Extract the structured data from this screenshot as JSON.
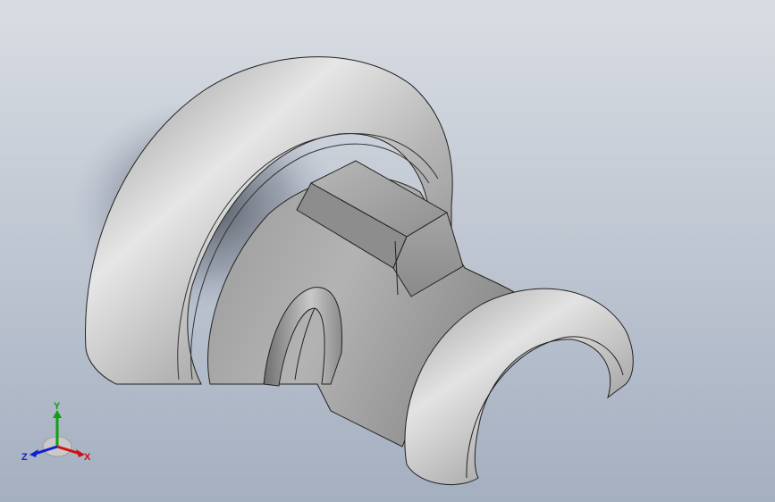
{
  "viewport": {
    "background_top": "#d9dde3",
    "background_bottom": "#a4afc0",
    "model_color": "#a9a9a9"
  },
  "triad": {
    "x_label": "X",
    "y_label": "Y",
    "z_label": "Z",
    "x_color": "#d01010",
    "y_color": "#10a010",
    "z_color": "#1020d0"
  }
}
